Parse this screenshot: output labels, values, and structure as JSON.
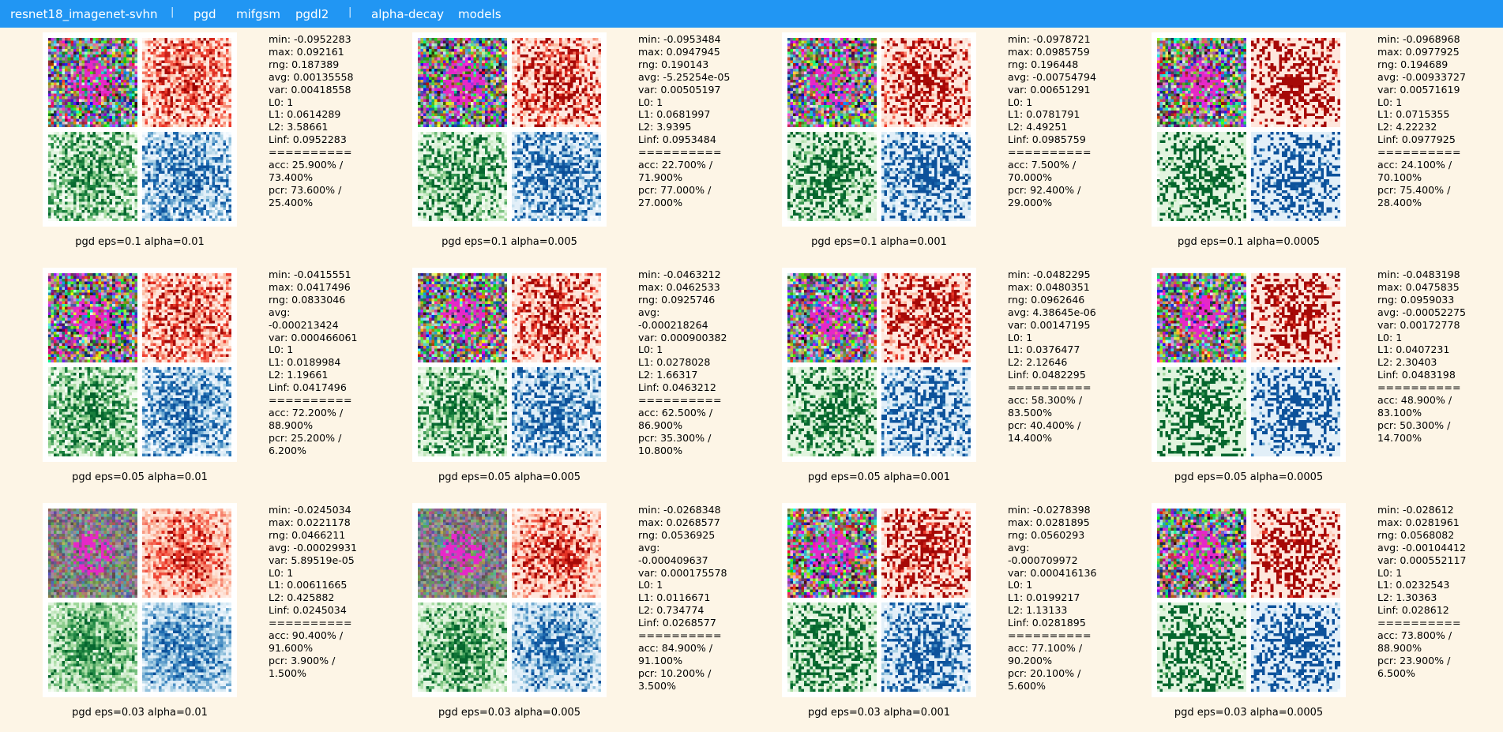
{
  "nav": {
    "items": [
      {
        "label": "resnet18_imagenet-svhn",
        "type": "link"
      },
      {
        "label": "|",
        "type": "sep"
      },
      {
        "label": "pgd",
        "type": "link"
      },
      {
        "label": "mifgsm",
        "type": "link"
      },
      {
        "label": "pgdl2",
        "type": "link"
      },
      {
        "label": "|",
        "type": "sep"
      },
      {
        "label": "alpha-decay",
        "type": "link"
      },
      {
        "label": "models",
        "type": "link"
      }
    ]
  },
  "colors": {
    "nav_bg": "#2196f3",
    "page_bg": "#fdf5e6",
    "red": "#990000",
    "green": "#00602a",
    "blue": "#0a4c96"
  },
  "panels": [
    {
      "caption": "pgd eps=0.1 alpha=0.01",
      "stats": [
        "min: -0.0952283",
        "max: 0.092161",
        "rng: 0.187389",
        "avg: 0.00135558",
        "var: 0.00418558",
        "L0: 1",
        "L1: 0.0614289",
        "L2: 3.58661",
        "Linf: 0.0952283",
        "==========",
        "acc: 25.900% /",
        "73.400%",
        "pcr: 73.600% /",
        "25.400%"
      ]
    },
    {
      "caption": "pgd eps=0.1 alpha=0.005",
      "stats": [
        "min: -0.0953484",
        "max: 0.0947945",
        "rng: 0.190143",
        "avg: -5.25254e-05",
        "var: 0.00505197",
        "L0: 1",
        "L1: 0.0681997",
        "L2: 3.9395",
        "Linf: 0.0953484",
        "==========",
        "acc: 22.700% /",
        "71.900%",
        "pcr: 77.000% /",
        "27.000%"
      ]
    },
    {
      "caption": "pgd eps=0.1 alpha=0.001",
      "stats": [
        "min: -0.0978721",
        "max: 0.0985759",
        "rng: 0.196448",
        "avg: -0.00754794",
        "var: 0.00651291",
        "L0: 1",
        "L1: 0.0781791",
        "L2: 4.49251",
        "Linf: 0.0985759",
        "==========",
        "acc: 7.500% /",
        "70.000%",
        "pcr: 92.400% /",
        "29.000%"
      ]
    },
    {
      "caption": "pgd eps=0.1 alpha=0.0005",
      "stats": [
        "min: -0.0968968",
        "max: 0.0977925",
        "rng: 0.194689",
        "avg: -0.00933727",
        "var: 0.00571619",
        "L0: 1",
        "L1: 0.0715355",
        "L2: 4.22232",
        "Linf: 0.0977925",
        "==========",
        "acc: 24.100% /",
        "70.100%",
        "pcr: 75.400% /",
        "28.400%"
      ]
    },
    {
      "caption": "pgd eps=0.05 alpha=0.01",
      "stats": [
        "min: -0.0415551",
        "max: 0.0417496",
        "rng: 0.0833046",
        "avg:",
        "-0.000213424",
        "var: 0.000466061",
        "L0: 1",
        "L1: 0.0189984",
        "L2: 1.19661",
        "Linf: 0.0417496",
        "==========",
        "acc: 72.200% /",
        "88.900%",
        "pcr: 25.200% /",
        "6.200%"
      ]
    },
    {
      "caption": "pgd eps=0.05 alpha=0.005",
      "stats": [
        "min: -0.0463212",
        "max: 0.0462533",
        "rng: 0.0925746",
        "avg:",
        "-0.000218264",
        "var: 0.000900382",
        "L0: 1",
        "L1: 0.0278028",
        "L2: 1.66317",
        "Linf: 0.0463212",
        "==========",
        "acc: 62.500% /",
        "86.900%",
        "pcr: 35.300% /",
        "10.800%"
      ]
    },
    {
      "caption": "pgd eps=0.05 alpha=0.001",
      "stats": [
        "min: -0.0482295",
        "max: 0.0480351",
        "rng: 0.0962646",
        "avg: 4.38645e-06",
        "var: 0.00147195",
        "L0: 1",
        "L1: 0.0376477",
        "L2: 2.12646",
        "Linf: 0.0482295",
        "==========",
        "acc: 58.300% /",
        "83.500%",
        "pcr: 40.400% /",
        "14.400%"
      ]
    },
    {
      "caption": "pgd eps=0.05 alpha=0.0005",
      "stats": [
        "min: -0.0483198",
        "max: 0.0475835",
        "rng: 0.0959033",
        "avg: -0.00052275",
        "var: 0.00172778",
        "L0: 1",
        "L1: 0.0407231",
        "L2: 2.30403",
        "Linf: 0.0483198",
        "==========",
        "acc: 48.900% /",
        "83.100%",
        "pcr: 50.300% /",
        "14.700%"
      ]
    },
    {
      "caption": "pgd eps=0.03 alpha=0.01",
      "stats": [
        "min: -0.0245034",
        "max: 0.0221178",
        "rng: 0.0466211",
        "avg: -0.00029931",
        "var: 5.89519e-05",
        "L0: 1",
        "L1: 0.00611665",
        "L2: 0.425882",
        "Linf: 0.0245034",
        "==========",
        "acc: 90.400% /",
        "91.600%",
        "pcr: 3.900% /",
        "1.500%"
      ]
    },
    {
      "caption": "pgd eps=0.03 alpha=0.005",
      "stats": [
        "min: -0.0268348",
        "max: 0.0268577",
        "rng: 0.0536925",
        "avg:",
        "-0.000409637",
        "var: 0.000175578",
        "L0: 1",
        "L1: 0.0116671",
        "L2: 0.734774",
        "Linf: 0.0268577",
        "==========",
        "acc: 84.900% /",
        "91.100%",
        "pcr: 10.200% /",
        "3.500%"
      ]
    },
    {
      "caption": "pgd eps=0.03 alpha=0.001",
      "stats": [
        "min: -0.0278398",
        "max: 0.0281895",
        "rng: 0.0560293",
        "avg:",
        "-0.000709972",
        "var: 0.000416136",
        "L0: 1",
        "L1: 0.0199217",
        "L2: 1.13133",
        "Linf: 0.0281895",
        "==========",
        "acc: 77.100% /",
        "90.200%",
        "pcr: 20.100% /",
        "5.600%"
      ]
    },
    {
      "caption": "pgd eps=0.03 alpha=0.0005",
      "stats": [
        "min: -0.028612",
        "max: 0.0281961",
        "rng: 0.0568082",
        "avg: -0.00104412",
        "var: 0.000552117",
        "L0: 1",
        "L1: 0.0232543",
        "L2: 1.30363",
        "Linf: 0.028612",
        "==========",
        "acc: 73.800% /",
        "88.900%",
        "pcr: 23.900% /",
        "6.500%"
      ]
    }
  ]
}
